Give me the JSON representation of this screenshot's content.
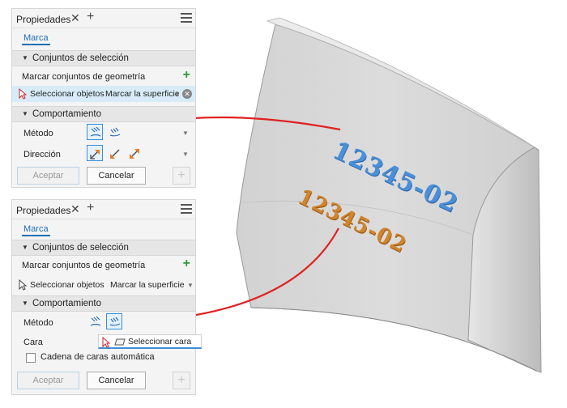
{
  "panel1": {
    "title": "Propiedades",
    "close_glyph": "✕",
    "add_glyph": "+",
    "tab": "Marca",
    "selection_section": "Conjuntos de selección",
    "geometry_label": "Marcar conjuntos de geometría",
    "select_objects": "Seleccionar objetos",
    "mark_surface": "Marcar la superficie",
    "behavior_section": "Comportamiento",
    "method_label": "Método",
    "direction_label": "Dirección",
    "accept": "Aceptar",
    "cancel": "Cancelar"
  },
  "panel2": {
    "title": "Propiedades",
    "close_glyph": "✕",
    "add_glyph": "+",
    "tab": "Marca",
    "selection_section": "Conjuntos de selección",
    "geometry_label": "Marcar conjuntos de geometría",
    "select_objects": "Seleccionar objetos",
    "mark_surface": "Marcar la superficie",
    "behavior_section": "Comportamiento",
    "method_label": "Método",
    "face_label": "Cara",
    "select_face": "Seleccionar cara",
    "auto_chain": "Cadena de caras automática",
    "accept": "Aceptar",
    "cancel": "Cancelar"
  },
  "model": {
    "mark_text_top": "12345-02",
    "mark_text_bottom": "12345-02"
  },
  "colors": {
    "accent": "#1a6fb5",
    "callout_line": "#e02020",
    "emboss_blue": "#4a8fd8",
    "emboss_orange": "#d0842c",
    "green_add": "#2e9a3c"
  }
}
